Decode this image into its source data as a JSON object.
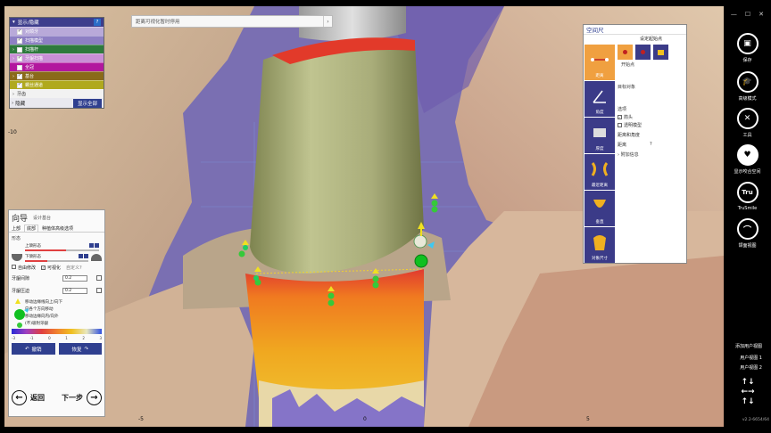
{
  "hint": {
    "placeholder": "距离可视化暂时停用"
  },
  "visibility": {
    "title": "显示/隐藏",
    "help": "?",
    "items": [
      {
        "label": "对颌牙",
        "color": "#b8a9d9",
        "checked": true,
        "expandable": false
      },
      {
        "label": "扫描模型",
        "color": "#8d7fc4",
        "checked": true,
        "expandable": false
      },
      {
        "label": "扫描杆",
        "color": "#2e7a3d",
        "checked": false,
        "expandable": true
      },
      {
        "label": "牙龈扫描",
        "color": "#c98fd6",
        "checked": true,
        "expandable": true
      },
      {
        "label": "全冠",
        "color": "#b2179e",
        "checked": false,
        "expandable": false
      },
      {
        "label": "基台",
        "color": "#8a6a1a",
        "checked": true,
        "expandable": true
      },
      {
        "label": "螺丝通道",
        "color": "#b0a91e",
        "checked": true,
        "expandable": false
      }
    ],
    "extra_row": "牙齿",
    "hide_label": "隐藏",
    "show_all": "显示全部"
  },
  "wizard": {
    "title": "向导",
    "subtitle": "设计基台",
    "tabs": [
      "上部",
      "底部",
      "种植体高级选项"
    ],
    "active_tab": 1,
    "section_label": "形态",
    "slider1": {
      "label": "上颌形态",
      "fill": 0.55
    },
    "slider2": {
      "label": "下颌形态",
      "fill": 0.35
    },
    "check_free": "自由修改",
    "check_visual": "可视化",
    "check_custom": "自定义?",
    "param1": {
      "label": "牙龈间隙",
      "value": "0.2"
    },
    "param2": {
      "label": "牙龈压迫",
      "value": "0.2"
    },
    "legend": [
      "移动边缘线向上/向下",
      "向各个方向移动",
      "移动边缘向内/向外",
      "(不)吸附牙龈"
    ],
    "colorbar_labels": [
      "-3",
      "-1",
      "0",
      "1",
      "2",
      "3"
    ],
    "undo": "撤销",
    "redo": "恢复",
    "back": "返回",
    "next": "下一步"
  },
  "measure": {
    "title": "空间尺",
    "set_start": "设定起始点",
    "start_point": "开始点",
    "target": "目标对象",
    "options": "选项",
    "opt_arrow": "箭头",
    "opt_transparent": "透明模型",
    "distance_angle": "距离和角度",
    "distance": "距离",
    "question": "?",
    "more_info": "附加信息",
    "tools": [
      "距离",
      "角度",
      "厚度",
      "最近距离",
      "垂直",
      "对象尺寸"
    ]
  },
  "toolbar": {
    "win_controls": [
      "—",
      "☐",
      "✕"
    ],
    "save": "保存",
    "expert": "高级模式",
    "tools": "工具",
    "show_prox": "显示咬合空间",
    "trusmile": "TruSmile",
    "trusmile_icon": "Tru",
    "arch": "颌面视图",
    "add_view": "添加用户视图",
    "view1": "用户视图 1",
    "view2": "用户视图 2",
    "version": "v2.2-6654/64"
  },
  "axis_labels": [
    "-10",
    "-5",
    "0",
    "5"
  ],
  "colors": {
    "viewport_bg": "#7a6fb2",
    "panel_blue": "#3b3b88",
    "accent_orange": "#f0a040"
  }
}
